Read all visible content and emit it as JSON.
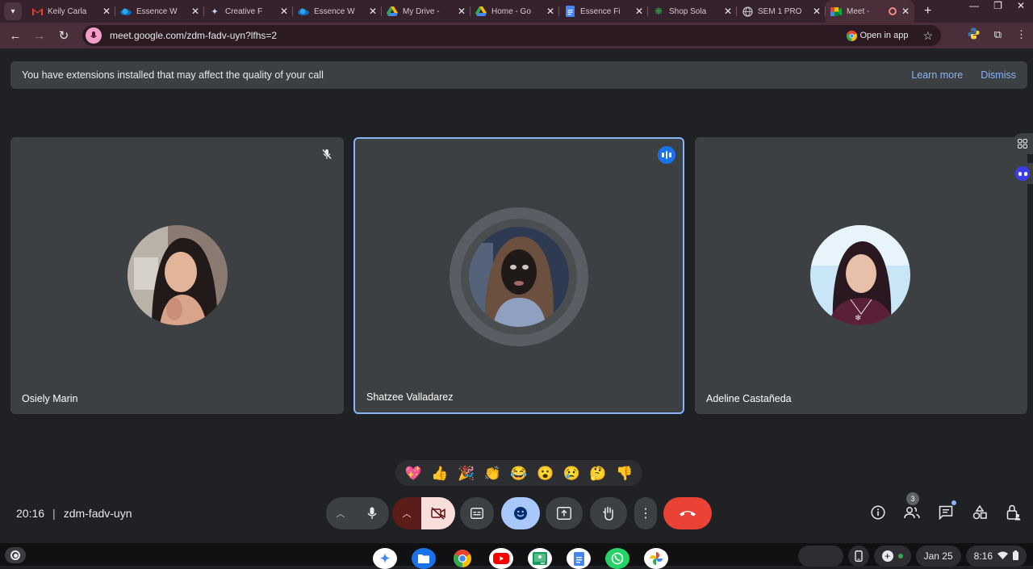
{
  "browser": {
    "tabs": [
      {
        "title": "Keily Carla",
        "icon": "gmail-icon"
      },
      {
        "title": "Essence W",
        "icon": "onedrive-icon"
      },
      {
        "title": "Creative F",
        "icon": "sparkle-icon"
      },
      {
        "title": "Essence W",
        "icon": "onedrive-icon"
      },
      {
        "title": "My Drive - ",
        "icon": "drive-icon"
      },
      {
        "title": "Home - Go",
        "icon": "drive-icon"
      },
      {
        "title": "Essence Fi",
        "icon": "docs-icon"
      },
      {
        "title": "Shop Sola",
        "icon": "shop-icon"
      },
      {
        "title": "SEM 1 PRO",
        "icon": "globe-icon"
      },
      {
        "title": "Meet - ",
        "icon": "meet-icon",
        "active": true
      }
    ],
    "url": "meet.google.com/zdm-fadv-uyn?lfhs=2",
    "open_in_app": "Open in app"
  },
  "banner": {
    "message": "You have extensions installed that may affect the quality of your call",
    "learn_more": "Learn more",
    "dismiss": "Dismiss"
  },
  "participants": [
    {
      "name": "Osiely Marin",
      "muted": true,
      "speaking": false
    },
    {
      "name": "Shatzee Valladarez",
      "muted": false,
      "speaking": true
    },
    {
      "name": "Adeline Castañeda",
      "muted": false,
      "speaking": false
    }
  ],
  "reactions": [
    "💖",
    "👍",
    "🎉",
    "👏",
    "😂",
    "😮",
    "😢",
    "🤔",
    "👎"
  ],
  "meeting": {
    "time": "20:16",
    "code": "zdm-fadv-uyn",
    "participant_count": "3"
  },
  "shelf": {
    "date": "Jan 25",
    "time": "8:16"
  },
  "colors": {
    "accent": "#8ab4f8",
    "end_call": "#ea4335",
    "tile_bg": "#3c4043",
    "page_bg": "#202124"
  }
}
